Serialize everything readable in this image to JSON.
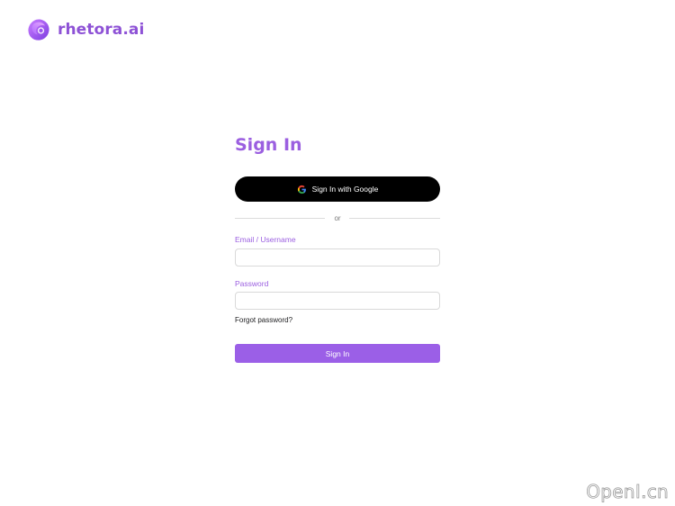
{
  "brand": {
    "name": "rhetora.ai",
    "logo_icon": "rhetora-logo-icon",
    "color": "#8e52d6"
  },
  "form": {
    "title": "Sign In",
    "google_button": {
      "label": "Sign In with Google",
      "icon": "google-icon"
    },
    "divider_text": "or",
    "email": {
      "label": "Email / Username",
      "value": "",
      "placeholder": ""
    },
    "password": {
      "label": "Password",
      "value": "",
      "placeholder": ""
    },
    "forgot_link": "Forgot password?",
    "submit_label": "Sign In",
    "accent_color": "#9b5fe7"
  },
  "watermark": {
    "text": "OpenI.cn"
  }
}
